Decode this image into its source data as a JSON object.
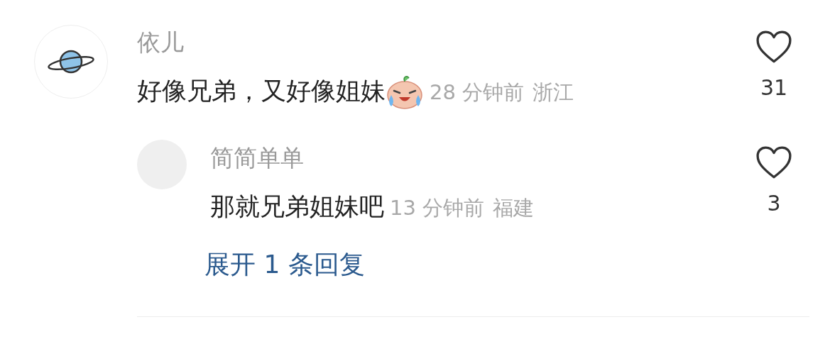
{
  "comment": {
    "author": "依儿",
    "text": "好像兄弟，又好像姐妹",
    "time": "28 分钟前",
    "location": "浙江",
    "likes": "31"
  },
  "reply": {
    "author": "简简单单",
    "text": "那就兄弟姐妹吧",
    "time": "13 分钟前",
    "location": "福建",
    "likes": "3"
  },
  "expand_link": "展开 1 条回复"
}
